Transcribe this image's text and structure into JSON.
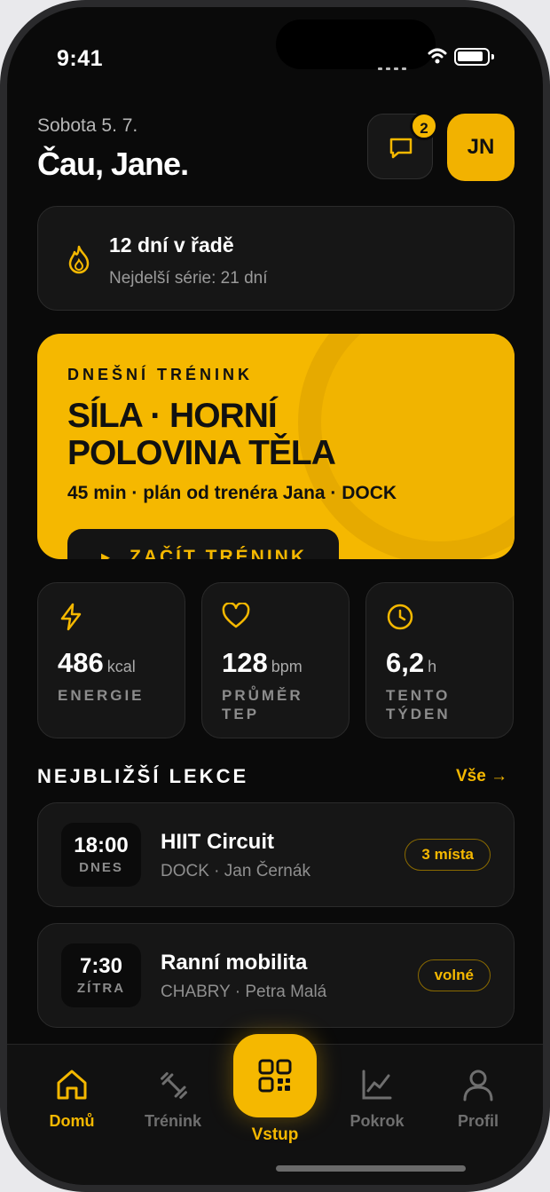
{
  "status_bar": {
    "time": "9:41"
  },
  "header": {
    "date": "Sobota 5. 7.",
    "greeting": "Čau, Jane.",
    "messages_badge": "2",
    "avatar_initials": "JN"
  },
  "streak": {
    "title": "12 dní v řadě",
    "subtitle": "Nejdelší série: 21 dní"
  },
  "today_workout": {
    "kicker": "DNEŠNÍ TRÉNINK",
    "title": "SÍLA · HORNÍ POLOVINA TĚLA",
    "meta": "45 min · plán od trenéra Jana · DOCK",
    "start_label": "ZAČÍT TRÉNINK",
    "start_icon": "▶"
  },
  "stats": [
    {
      "icon": "lightning-icon",
      "value": "486",
      "unit": "kcal",
      "label": "ENERGIE"
    },
    {
      "icon": "heart-icon",
      "value": "128",
      "unit": "bpm",
      "label": "PRŮMĚR TEP"
    },
    {
      "icon": "clock-icon",
      "value": "6,2",
      "unit": "h",
      "label": "TENTO TÝDEN"
    }
  ],
  "lessons_section": {
    "title": "NEJBLIŽŠÍ LEKCE",
    "see_all": "Vše →",
    "items": [
      {
        "time": "18:00",
        "day": "DNES",
        "name": "HIIT Circuit",
        "detail": "DOCK · Jan Černák",
        "availability": "3 místa"
      },
      {
        "time": "7:30",
        "day": "ZÍTRA",
        "name": "Ranní mobilita",
        "detail": "CHABRY · Petra Malá",
        "availability": "volné"
      }
    ]
  },
  "tabbar": {
    "items": [
      {
        "label": "Domů",
        "icon": "home-icon",
        "active": true
      },
      {
        "label": "Trénink",
        "icon": "dumbbell-icon",
        "active": false
      },
      {
        "label": "Vstup",
        "icon": "qr-code-icon",
        "active": false
      },
      {
        "label": "Pokrok",
        "icon": "chart-icon",
        "active": false
      },
      {
        "label": "Profil",
        "icon": "user-icon",
        "active": false
      }
    ]
  },
  "colors": {
    "accent": "#f5b800",
    "background": "#0a0a0a",
    "card": "#161616"
  }
}
